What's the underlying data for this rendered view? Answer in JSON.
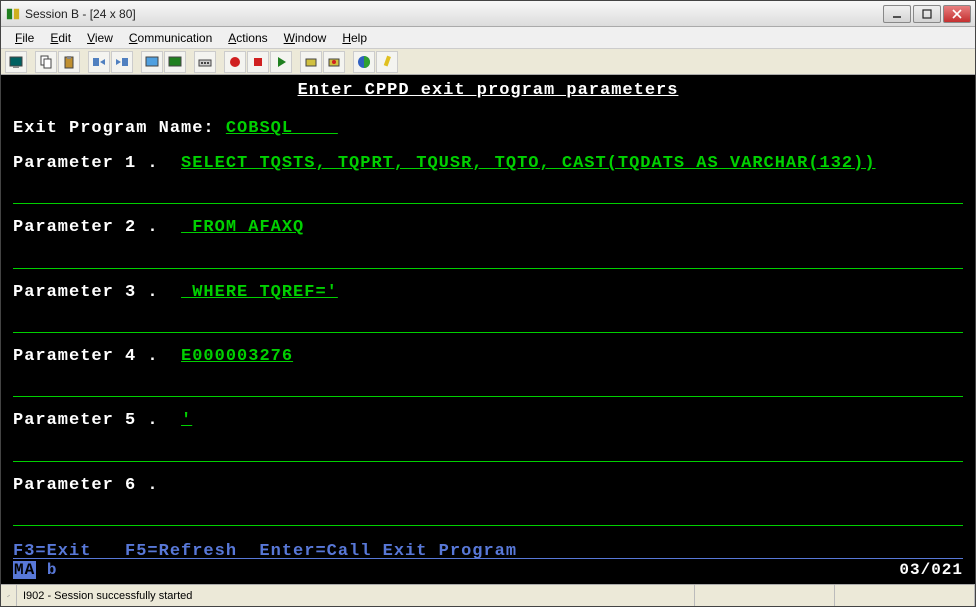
{
  "window": {
    "title": "Session B - [24 x 80]"
  },
  "menu": {
    "file": "File",
    "edit": "Edit",
    "view": "View",
    "communication": "Communication",
    "actions": "Actions",
    "window": "Window",
    "help": "Help"
  },
  "terminal": {
    "title": "Enter CPPD exit program parameters",
    "exit_program_label": "Exit Program Name: ",
    "exit_program_value": "COBSQL    ",
    "params": [
      {
        "label": "Parameter 1 .  ",
        "value": "SELECT TQSTS, TQPRT, TQUSR, TQTO, CAST(TQDATS AS VARCHAR(132))"
      },
      {
        "label": "Parameter 2 .  ",
        "value": " FROM AFAXQ"
      },
      {
        "label": "Parameter 3 .  ",
        "value": " WHERE TQREF='"
      },
      {
        "label": "Parameter 4 .  ",
        "value": "E000003276"
      },
      {
        "label": "Parameter 5 .  ",
        "value": "'"
      },
      {
        "label": "Parameter 6 .  ",
        "value": ""
      }
    ],
    "fn_keys": "F3=Exit   F5=Refresh  Enter=Call Exit Program",
    "status_ma": "MA",
    "status_b": "b",
    "cursor_pos": "03/021"
  },
  "statusbar": {
    "message": "I902 - Session successfully started"
  }
}
